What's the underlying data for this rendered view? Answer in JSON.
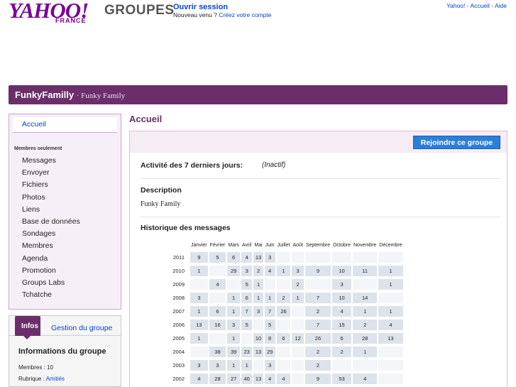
{
  "header": {
    "logo_text": "YAHOO!",
    "logo_sub": "FRANCE",
    "logo_groupes": "GROUPES",
    "signin": "Ouvrir session",
    "newuser_text": "Nouveau venu ?",
    "create_account": "Créez votre compte",
    "links": [
      "Yahoo!",
      "Accueil",
      "Aide"
    ]
  },
  "banner": {
    "name": "FunkyFamilly",
    "subtitle": "· Funky Family"
  },
  "sidebar": {
    "home": "Accueil",
    "members_title": "Membres seulement",
    "items": [
      "Messages",
      "Envoyer",
      "Fichiers",
      "Photos",
      "Liens",
      "Base de données",
      "Sondages",
      "Membres",
      "Agenda",
      "Promotion",
      "Groups Labs",
      "Tchatche"
    ]
  },
  "infobox": {
    "tab_infos": "Infos",
    "tab_manage": "Gestion du groupe",
    "title": "Informations du groupe",
    "members_label": "Membres : 10",
    "category_label": "Rubrique : ",
    "category_value": "Amitiés"
  },
  "main": {
    "title": "Accueil",
    "join_button": "Rejoindre ce groupe",
    "activity_label": "Activité des 7 derniers jours:",
    "activity_value": "(Inactif)",
    "description_label": "Description",
    "description_value": "Funky Family",
    "history_label": "Historique des messages"
  },
  "history": {
    "months": [
      "Janvier",
      "Février",
      "Mars",
      "Avril",
      "Mai",
      "Juin",
      "Juillet",
      "Août",
      "Septembre",
      "Octobre",
      "Novembre",
      "Décembre"
    ],
    "rows": [
      {
        "year": "2011",
        "counts": [
          "9",
          "5",
          "6",
          "4",
          "13",
          "3",
          "",
          "",
          "",
          "",
          "",
          ""
        ]
      },
      {
        "year": "2010",
        "counts": [
          "1",
          "",
          "29",
          "3",
          "2",
          "4",
          "1",
          "3",
          "9",
          "10",
          "11",
          "1"
        ]
      },
      {
        "year": "2009",
        "counts": [
          "",
          "4",
          "",
          "5",
          "1",
          "",
          "",
          "2",
          "",
          "3",
          "",
          "1"
        ]
      },
      {
        "year": "2008",
        "counts": [
          "3",
          "",
          "1",
          "6",
          "1",
          "1",
          "2",
          "1",
          "7",
          "10",
          "14",
          ""
        ]
      },
      {
        "year": "2007",
        "counts": [
          "1",
          "6",
          "1",
          "7",
          "3",
          "7",
          "26",
          "",
          "2",
          "4",
          "1",
          "1"
        ]
      },
      {
        "year": "2006",
        "counts": [
          "13",
          "16",
          "3",
          "5",
          "",
          "5",
          "",
          "",
          "7",
          "15",
          "2",
          "4"
        ]
      },
      {
        "year": "2005",
        "counts": [
          "1",
          "",
          "1",
          "",
          "10",
          "8",
          "6",
          "12",
          "26",
          "6",
          "28",
          "13"
        ]
      },
      {
        "year": "2004",
        "counts": [
          "",
          "38",
          "39",
          "23",
          "13",
          "29",
          "",
          "",
          "2",
          "2",
          "1",
          ""
        ]
      },
      {
        "year": "2003",
        "counts": [
          "3",
          "3",
          "1",
          "1",
          "",
          "3",
          "",
          "",
          "2",
          "",
          "",
          ""
        ]
      },
      {
        "year": "2002",
        "counts": [
          "4",
          "28",
          "27",
          "40",
          "13",
          "4",
          "4",
          "",
          "9",
          "53",
          "4",
          ""
        ]
      }
    ]
  }
}
